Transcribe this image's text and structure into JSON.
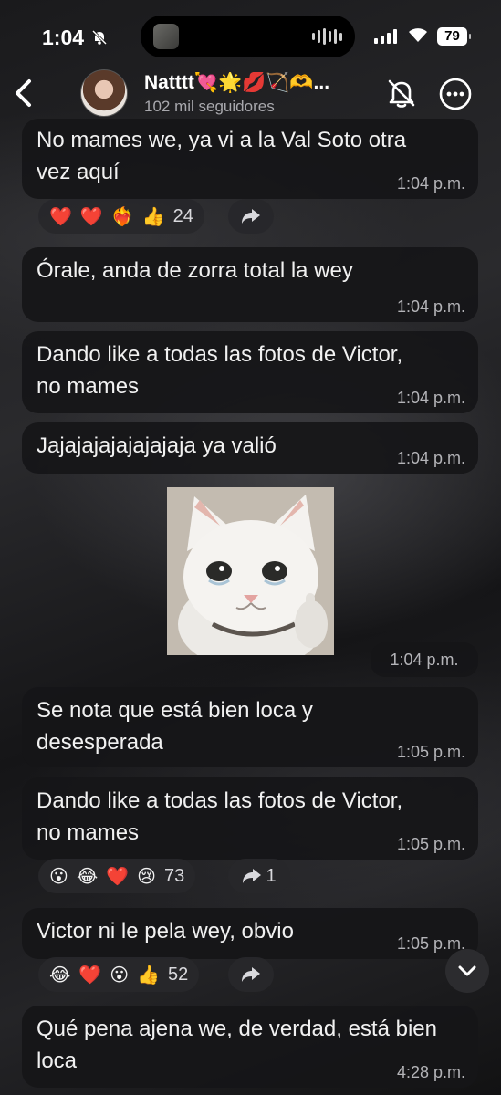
{
  "status_bar": {
    "time": "1:04",
    "battery": "79"
  },
  "header": {
    "title": "Natttt💘🌟💋🏹🫶...",
    "subtitle": "102 mil seguidores"
  },
  "messages": [
    {
      "text": "No mames we, ya vi a la Val Soto otra vez aquí",
      "time": "1:04 p.m.",
      "reactions": {
        "emojis": [
          "❤️",
          "❤️",
          "❤️‍🔥",
          "👍"
        ],
        "count": "24"
      },
      "share": ""
    },
    {
      "text": "Órale, anda de zorra total la wey",
      "time": "1:04 p.m."
    },
    {
      "text": "Dando like a todas las fotos de Victor, no mames",
      "time": "1:04 p.m."
    },
    {
      "text": "Jajajajajajajajaja ya valió",
      "time": "1:04 p.m."
    },
    {
      "sticker": "crying-cat-thumbs-up",
      "time": "1:04 p.m."
    },
    {
      "text": "Se nota que está bien loca y desesperada",
      "time": "1:05 p.m."
    },
    {
      "text": "Dando like a todas las fotos de Victor, no mames",
      "time": "1:05 p.m.",
      "reactions": {
        "emojis": [
          "😮",
          "😂",
          "❤️",
          "😢"
        ],
        "count": "73"
      },
      "share": "1"
    },
    {
      "text": "Victor ni le pela wey, obvio",
      "time": "1:05 p.m.",
      "reactions": {
        "emojis": [
          "😂",
          "❤️",
          "😮",
          "👍"
        ],
        "count": "52"
      },
      "share": ""
    },
    {
      "text": "Qué pena ajena we, de verdad, está bien loca",
      "time": "4:28 p.m."
    }
  ],
  "colors": {
    "bubble": "#161618",
    "timestamp": "#b4b4b8",
    "subtitle": "#a8a8ad"
  },
  "icons": {
    "back": "chevron-left-icon",
    "mute": "bell-off-icon",
    "more": "more-horizontal-icon",
    "share": "share-arrow-icon",
    "scroll": "chevron-down-icon"
  }
}
